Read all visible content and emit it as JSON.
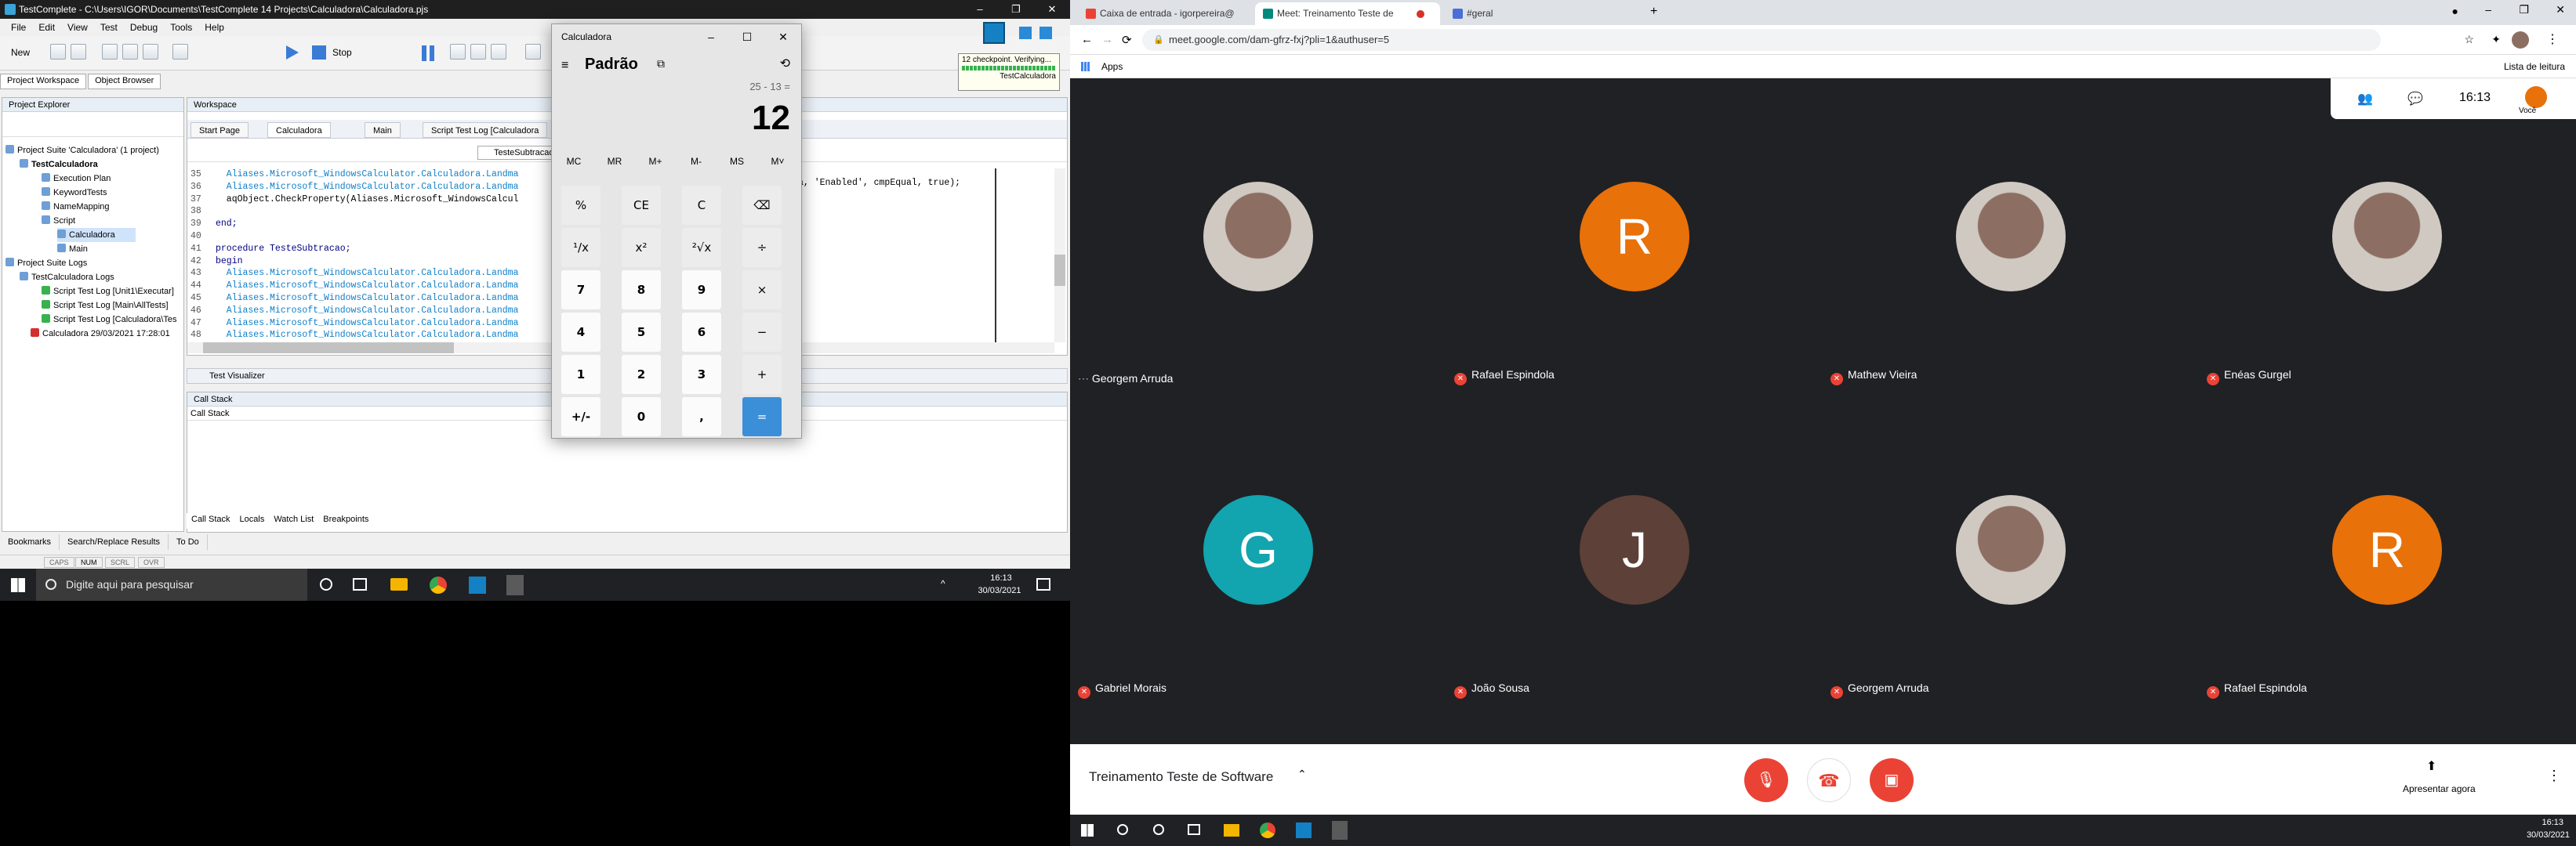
{
  "testcomplete": {
    "title": "TestComplete - C:\\Users\\IGOR\\Documents\\TestComplete 14 Projects\\Calculadora\\Calculadora.pjs",
    "menu": [
      "File",
      "Edit",
      "View",
      "Test",
      "Debug",
      "Tools",
      "Help"
    ],
    "toolbar": {
      "new_label": "New",
      "stop_label": "Stop"
    },
    "top_tabs": [
      "Project Workspace",
      "Object Browser"
    ],
    "checkpoint": {
      "line1": "12 checkpoint. Verifying...",
      "line2": "TestCalculadora"
    },
    "project_explorer": {
      "title": "Project Explorer",
      "tree": [
        "Project Suite 'Calculadora' (1 project)",
        "TestCalculadora",
        "Execution Plan",
        "KeywordTests",
        "NameMapping",
        "Script",
        "Calculadora",
        "Main",
        "Project Suite Logs",
        "TestCalculadora Logs",
        "Script Test Log [Unit1\\Executar]",
        "Script Test Log [Main\\AllTests]",
        "Script Test Log [Calculadora\\Tes",
        "Calculadora 29/03/2021 17:28:01"
      ]
    },
    "workspace": {
      "title": "Workspace",
      "tabs": [
        "Start Page",
        "Calculadora",
        "Main",
        "Script Test Log [Calculadora"
      ],
      "routine": "TesteSubtracao",
      "code": [
        {
          "n": "35",
          "t": "  Aliases.Microsoft_WindowsCalculator.Calculadora.Landma"
        },
        {
          "n": "36",
          "t": "  Aliases.Microsoft_WindowsCalculator.Calculadora.Landma"
        },
        {
          "n": "37",
          "t": "  aqObject.CheckProperty(Aliases.Microsoft_WindowsCalcul"
        },
        {
          "n": "38",
          "t": ""
        },
        {
          "n": "39",
          "t": "end;"
        },
        {
          "n": "40",
          "t": ""
        },
        {
          "n": "41",
          "t": "procedure TesteSubtracao;"
        },
        {
          "n": "42",
          "t": "begin"
        },
        {
          "n": "43",
          "t": "  Aliases.Microsoft_WindowsCalculator.Calculadora.Landma"
        },
        {
          "n": "44",
          "t": "  Aliases.Microsoft_WindowsCalculator.Calculadora.Landma"
        },
        {
          "n": "45",
          "t": "  Aliases.Microsoft_WindowsCalculator.Calculadora.Landma"
        },
        {
          "n": "46",
          "t": "  Aliases.Microsoft_WindowsCalculator.Calculadora.Landma"
        },
        {
          "n": "47",
          "t": "  Aliases.Microsoft_WindowsCalculator.Calculadora.Landma"
        },
        {
          "n": "48",
          "t": "  Aliases.Microsoft_WindowsCalculator.Calculadora.Landma"
        }
      ],
      "code_right": "r_o.Igual_a, 'Enabled', cmpEqual, true);"
    },
    "test_visualizer": "Test Visualizer",
    "call_stack": {
      "title": "Call Stack",
      "header": "Call Stack"
    },
    "debug_tabs": [
      "Call Stack",
      "Locals",
      "Watch List",
      "Breakpoints"
    ],
    "bottom_tabs": [
      "Bookmarks",
      "Search/Replace Results",
      "To Do"
    ],
    "status": [
      "CAPS",
      "NUM",
      "SCRL",
      "OVR"
    ]
  },
  "taskbar_left": {
    "search": "Digite aqui para pesquisar",
    "time": "16:13",
    "date": "30/03/2021"
  },
  "calculator": {
    "title": "Calculadora",
    "mode": "Padrão",
    "expression": "25 - 13 =",
    "display": "12",
    "memory": [
      "MC",
      "MR",
      "M+",
      "M-",
      "MS",
      "M˅"
    ],
    "keys": [
      [
        "%",
        "CE",
        "C",
        "⌫"
      ],
      [
        "¹/x",
        "x²",
        "²√x",
        "÷"
      ],
      [
        "7",
        "8",
        "9",
        "×"
      ],
      [
        "4",
        "5",
        "6",
        "−"
      ],
      [
        "1",
        "2",
        "3",
        "+"
      ],
      [
        "+/-",
        "0",
        ",",
        "="
      ]
    ]
  },
  "chrome": {
    "tabs": [
      {
        "label": "Caixa de entrada - igorpereira@",
        "color": "#ea4335"
      },
      {
        "label": "Meet: Treinamento Teste de",
        "color": "#00897b"
      },
      {
        "label": "#geral",
        "color": "#4a6fd8"
      }
    ],
    "url": "meet.google.com/dam-gfrz-fxj?pli=1&authuser=5",
    "bookmarks": "Apps",
    "reading_list": "Lista de leitura"
  },
  "meet": {
    "time": "16:13",
    "you_label": "Você",
    "participants": [
      {
        "name": "Georgem Arruda",
        "initial": "",
        "color": "#3c4043",
        "muted": false
      },
      {
        "name": "Rafael Espindola",
        "initial": "R",
        "color": "#e8710a",
        "muted": true
      },
      {
        "name": "Mathew Vieira",
        "initial": "",
        "color": "#3c4043",
        "muted": true
      },
      {
        "name": "Enéas Gurgel",
        "initial": "",
        "color": "#3c4043",
        "muted": true
      },
      {
        "name": "Gabriel Morais",
        "initial": "G",
        "color": "#12a4af",
        "muted": true
      },
      {
        "name": "João Sousa",
        "initial": "J",
        "color": "#5d4037",
        "muted": true
      },
      {
        "name": "Georgem Arruda",
        "initial": "",
        "color": "#3c4043",
        "muted": true
      },
      {
        "name": "Rafael Espindola",
        "initial": "R",
        "color": "#e8710a",
        "muted": true
      }
    ],
    "meeting_title": "Treinamento Teste de Software",
    "present_label": "Apresentar agora"
  },
  "taskbar_right": {
    "time": "16:13",
    "date": "30/03/2021"
  }
}
